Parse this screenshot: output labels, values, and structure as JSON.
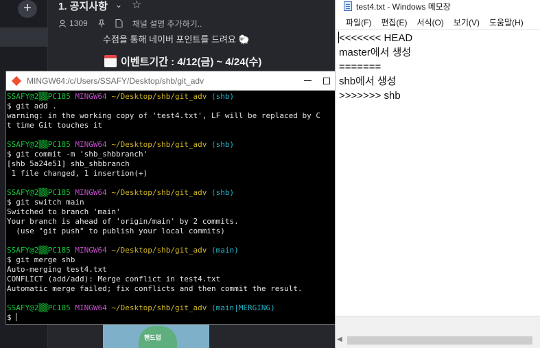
{
  "background_app": {
    "channel_title": "1. 공지사항",
    "member_count": "1309",
    "channel_description_placeholder": "채널 설명 추가하기..",
    "message_line_1": "수점을 통해 네이버 포인트를 드려요",
    "event_period": "이벤트기간 : 4/12(금) ~ 4/24(수)",
    "sticker_label": "핸드업"
  },
  "terminal": {
    "title": "MINGW64:/c/Users/SSAFY/Desktop/shb/git_adv",
    "blocks": [
      {
        "prompt": {
          "user": "SSAFY@2▒▒PC185",
          "host": "MINGW64",
          "path": "~/Desktop/shb/git_adv",
          "branch": "(shb)"
        },
        "command": "$ git add .",
        "output": [
          "warning: in the working copy of 'test4.txt', LF will be replaced by C",
          "t time Git touches it"
        ]
      },
      {
        "prompt": {
          "user": "SSAFY@2▒▒PC185",
          "host": "MINGW64",
          "path": "~/Desktop/shb/git_adv",
          "branch": "(shb)"
        },
        "command": "$ git commit -m 'shb_shbbranch'",
        "output": [
          "[shb 5a24e51] shb_shbbranch",
          " 1 file changed, 1 insertion(+)"
        ]
      },
      {
        "prompt": {
          "user": "SSAFY@2▒▒PC185",
          "host": "MINGW64",
          "path": "~/Desktop/shb/git_adv",
          "branch": "(shb)"
        },
        "command": "$ git switch main",
        "output": [
          "Switched to branch 'main'",
          "Your branch is ahead of 'origin/main' by 2 commits.",
          "  (use \"git push\" to publish your local commits)"
        ]
      },
      {
        "prompt": {
          "user": "SSAFY@2▒▒PC185",
          "host": "MINGW64",
          "path": "~/Desktop/shb/git_adv",
          "branch": "(main)"
        },
        "command": "$ git merge shb",
        "output": [
          "Auto-merging test4.txt",
          "CONFLICT (add/add): Merge conflict in test4.txt",
          "Automatic merge failed; fix conflicts and then commit the result."
        ]
      }
    ],
    "final_prompt": {
      "user": "SSAFY@2▒▒PC185",
      "host": "MINGW64",
      "path": "~/Desktop/shb/git_adv",
      "branch": "(main|MERGING)"
    },
    "input_prefix": "$ ",
    "colors": {
      "user": "#14c93a",
      "host": "#c050c8",
      "path": "#d2b824",
      "branch": "#24b4c8",
      "text": "#e5e5e5"
    }
  },
  "notepad": {
    "title": "test4.txt - Windows 메모장",
    "menu": [
      "파일(F)",
      "편집(E)",
      "서식(O)",
      "보기(V)",
      "도움말(H)"
    ],
    "lines": [
      "<<<<<<< HEAD",
      "master에서 생성",
      "=======",
      "shb에서 생성",
      ">>>>>>> shb"
    ]
  }
}
